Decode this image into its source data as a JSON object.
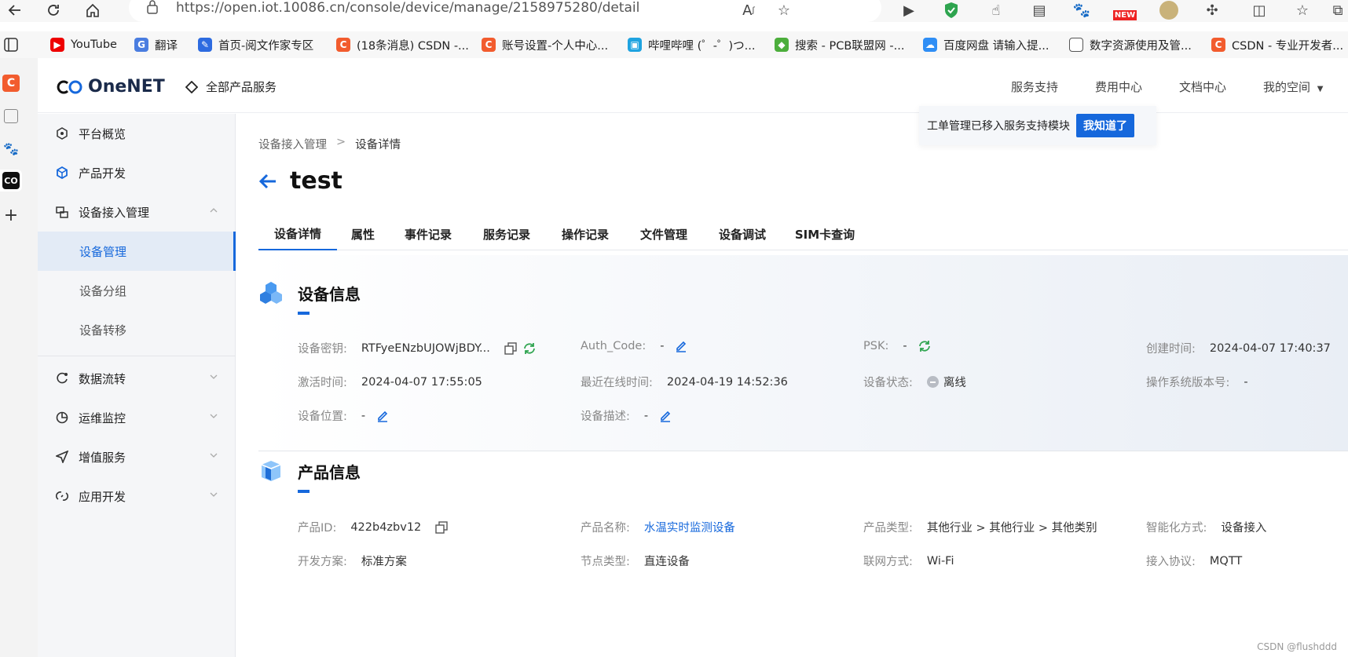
{
  "browser": {
    "url": "https://open.iot.10086.cn/console/device/manage/2158975280/detail",
    "bookmarks": [
      {
        "label": "YouTube",
        "icon": "youtube-icon"
      },
      {
        "label": "翻译",
        "icon": "translate-icon"
      },
      {
        "label": "首页-阅文作家专区",
        "icon": "pen-icon"
      },
      {
        "label": "(18条消息) CSDN -...",
        "icon": "csdn-icon"
      },
      {
        "label": "账号设置-个人中心...",
        "icon": "csdn-icon"
      },
      {
        "label": "哔哩哔哩 (゜-゜)つ...",
        "icon": "bilibili-icon"
      },
      {
        "label": "搜索 - PCB联盟网 -...",
        "icon": "pcb-icon"
      },
      {
        "label": "百度网盘 请输入提...",
        "icon": "baidu-pan-icon"
      },
      {
        "label": "数字资源使用及管...",
        "icon": "document-icon"
      },
      {
        "label": "CSDN - 专业开发者...",
        "icon": "csdn-icon"
      }
    ],
    "ext_badge": "NEW"
  },
  "header": {
    "logo": "OneNET",
    "all_products": "全部产品服务",
    "links": [
      "服务支持",
      "费用中心",
      "文档中心",
      "我的空间"
    ],
    "notice_text": "工单管理已移入服务支持模块",
    "notice_button": "我知道了"
  },
  "nav": {
    "items": [
      {
        "label": "平台概览"
      },
      {
        "label": "产品开发"
      },
      {
        "label": "设备接入管理"
      },
      {
        "label": "数据流转"
      },
      {
        "label": "运维监控"
      },
      {
        "label": "增值服务"
      },
      {
        "label": "应用开发"
      }
    ],
    "sub_items": [
      {
        "label": "设备管理"
      },
      {
        "label": "设备分组"
      },
      {
        "label": "设备转移"
      }
    ]
  },
  "main": {
    "breadcrumb": [
      "设备接入管理",
      ">",
      "设备详情"
    ],
    "title": "test",
    "tabs": [
      "设备详情",
      "属性",
      "事件记录",
      "服务记录",
      "操作记录",
      "文件管理",
      "设备调试",
      "SIM卡查询"
    ]
  },
  "device_info": {
    "heading": "设备信息",
    "key_label": "设备密钥:",
    "key_value": "RTFyeENzbUJOWjBDY...",
    "auth_label": "Auth_Code:",
    "auth_value": "-",
    "psk_label": "PSK:",
    "psk_value": "-",
    "created_label": "创建时间:",
    "created_value": "2024-04-07 17:40:37",
    "activated_label": "激活时间:",
    "activated_value": "2024-04-07 17:55:05",
    "last_online_label": "最近在线时间:",
    "last_online_value": "2024-04-19 14:52:36",
    "status_label": "设备状态:",
    "status_value": "离线",
    "os_label": "操作系统版本号:",
    "os_value": "-",
    "location_label": "设备位置:",
    "location_value": "-",
    "desc_label": "设备描述:",
    "desc_value": "-"
  },
  "product_info": {
    "heading": "产品信息",
    "id_label": "产品ID:",
    "id_value": "422b4zbv12",
    "name_label": "产品名称:",
    "name_value": "水温实时监测设备",
    "type_label": "产品类型:",
    "type_value": "其他行业 > 其他行业 > 其他类别",
    "smart_label": "智能化方式:",
    "smart_value": "设备接入",
    "dev_label": "开发方案:",
    "dev_value": "标准方案",
    "node_label": "节点类型:",
    "node_value": "直连设备",
    "network_label": "联网方式:",
    "network_value": "Wi-Fi",
    "protocol_label": "接入协议:",
    "protocol_value": "MQTT"
  },
  "watermark": "CSDN @flushddd"
}
